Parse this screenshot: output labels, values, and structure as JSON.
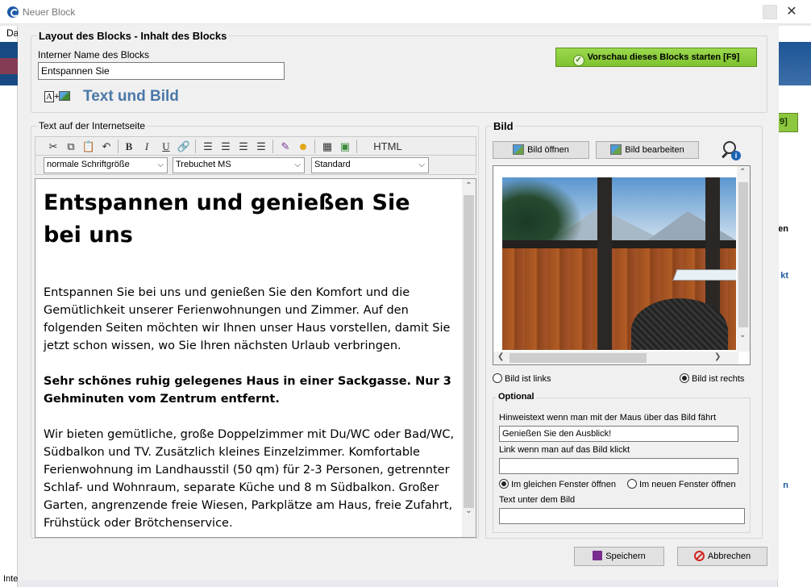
{
  "window": {
    "title": "Neuer Block"
  },
  "background": {
    "left_menu": "Da",
    "bottom_text": "Inte"
  },
  "layout_group": {
    "title": "Layout des Blocks - Inhalt des Blocks",
    "name_label": "Interner Name des Blocks",
    "name_value": "Entspannen Sie",
    "preview_button": "Vorschau dieses Blocks starten [F9]",
    "layout_label": "Text und Bild",
    "layout_icon_text": "A"
  },
  "editor_group": {
    "title": "Text auf der Internetseite",
    "html_button": "HTML",
    "font_size": "normale Schriftgröße",
    "font_family": "Trebuchet MS",
    "paragraph_style": "Standard",
    "heading": "Entspannen und genießen Sie bei uns",
    "paragraphs": [
      {
        "text": "Entspannen Sie bei uns und genießen Sie den Komfort und die Gemütlichkeit unserer Ferienwohnungen und Zimmer. Auf den folgenden Seiten möchten wir Ihnen unser Haus vorstellen, damit Sie jetzt schon wissen, wo Sie Ihren nächsten Urlaub verbringen."
      },
      {
        "text": "Sehr schönes ruhig gelegenes Haus in einer Sackgasse. Nur 3 Gehminuten vom Zentrum entfernt."
      },
      {
        "text": "Wir bieten gemütliche, große Doppelzimmer mit Du/WC oder Bad/WC, Südbalkon und TV. Zusätzlich kleines Einzelzimmer. Komfortable Ferienwohnung im Landhausstil (50 qm) für 2-3 Personen, getrennter Schlaf- und Wohnraum, separate Küche und 8 m Südbalkon. Großer Garten, angrenzende freie Wiesen, Parkplätze am Haus, freie Zufahrt, Frühstück oder Brötchenservice."
      }
    ]
  },
  "image_group": {
    "title": "Bild",
    "open_button": "Bild öffnen",
    "edit_button": "Bild bearbeiten",
    "radio_left": "Bild ist links",
    "radio_right": "Bild ist rechts",
    "optional_title": "Optional",
    "hover_label": "Hinweistext wenn man mit der Maus über das Bild fährt",
    "hover_value": "Genießen Sie den Ausblick!",
    "link_label": "Link wenn man auf das Bild klickt",
    "link_value": "",
    "same_window": "Im gleichen Fenster öffnen",
    "new_window": "Im neuen Fenster öffnen",
    "caption_label": "Text unter dem Bild",
    "caption_value": ""
  },
  "footer": {
    "save": "Speichern",
    "cancel": "Abbrechen"
  },
  "right_fragments": {
    "btn": "9]",
    "t1": "en",
    "t2": "kt",
    "t3": "n"
  }
}
